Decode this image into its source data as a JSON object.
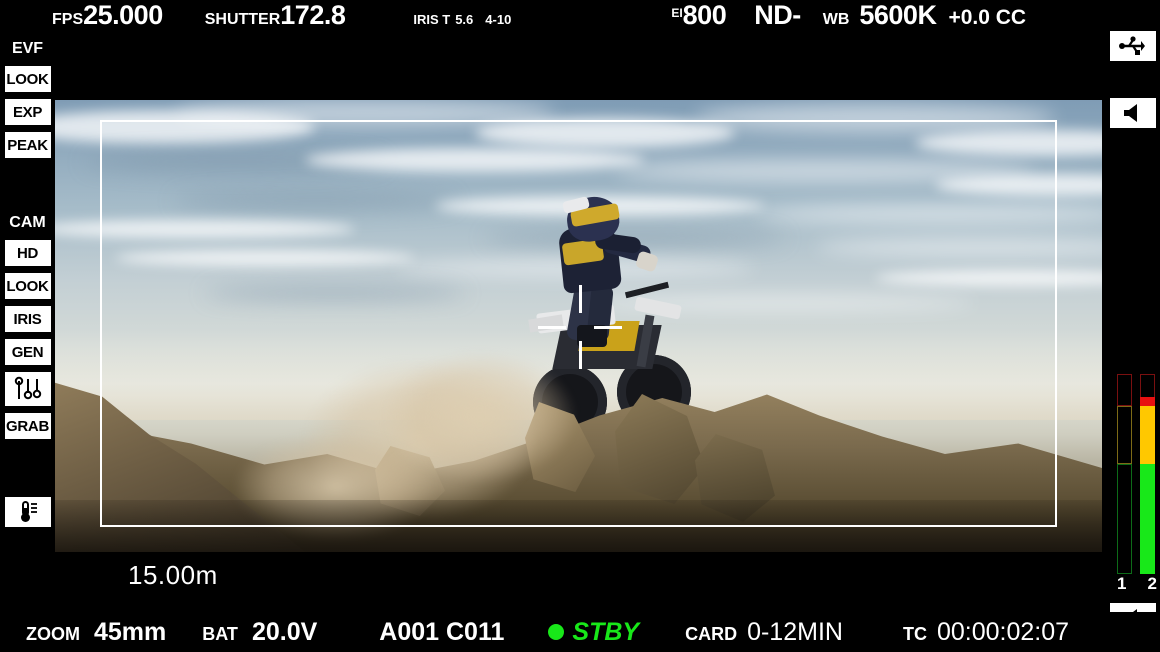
{
  "top_bar": {
    "fps": {
      "label": "FPS",
      "value": "25.000"
    },
    "shutter": {
      "label": "SHUTTER",
      "value": "172.8"
    },
    "iris": {
      "label": "IRIS T",
      "value": "5.6",
      "extra": "4-10"
    },
    "ei": {
      "label": "EI",
      "value": "800"
    },
    "nd": {
      "value": "ND-"
    },
    "wb": {
      "label": "WB",
      "value": "5600K",
      "cc": "+0.0 CC"
    }
  },
  "bottom_bar": {
    "zoom": {
      "label": "ZOOM",
      "value": "45mm"
    },
    "battery": {
      "label": "BAT",
      "value": "20.0V"
    },
    "clip": {
      "value": "A001 C011"
    },
    "record": {
      "status": "STBY",
      "dot_color": "#18e819"
    },
    "card": {
      "label": "CARD",
      "value": "0-12MIN"
    },
    "timecode": {
      "label": "TC",
      "value": "00:00:02:07"
    }
  },
  "sidebar": {
    "evf": {
      "title": "EVF",
      "buttons": [
        {
          "label": "LOOK",
          "name": "evf-look-button"
        },
        {
          "label": "EXP",
          "name": "evf-exp-button"
        },
        {
          "label": "PEAK",
          "name": "evf-peak-button"
        }
      ]
    },
    "cam": {
      "title": "CAM",
      "buttons": [
        {
          "label": "HD",
          "name": "cam-hd-button"
        },
        {
          "label": "LOOK",
          "name": "cam-look-button"
        },
        {
          "label": "IRIS",
          "name": "cam-iris-button"
        },
        {
          "label": "GEN",
          "name": "cam-gen-button"
        },
        {
          "label": "",
          "name": "cam-sliders-button",
          "icon": "sliders-icon"
        },
        {
          "label": "GRAB",
          "name": "cam-grab-button"
        }
      ]
    },
    "temperature_icon": "thermometer-icon"
  },
  "right_icons": {
    "usb": "usb-icon",
    "speaker_top": "speaker-icon",
    "speaker_bottom": "speaker-icon"
  },
  "audio_meters": {
    "channels": [
      {
        "label": "1",
        "level": 0
      },
      {
        "label": "2",
        "level": 88
      }
    ],
    "colors": {
      "red": "#e81010",
      "yellow": "#ffc800",
      "green": "#18e819"
    }
  },
  "overlay": {
    "focus_distance": "15.00m",
    "frame_guide_color": "#ffffff",
    "center_marker": "center-crosshair"
  }
}
